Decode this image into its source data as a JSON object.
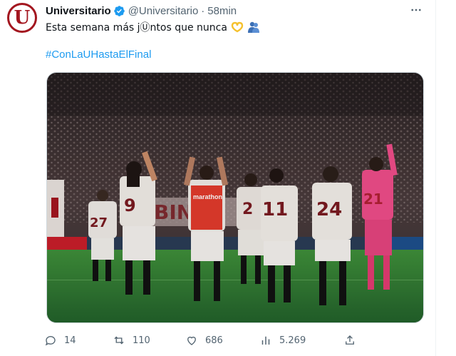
{
  "tweet": {
    "display_name": "Universitario",
    "handle": "@Universitario",
    "separator": "·",
    "time": "58min",
    "text": "Esta semana más jⓊntos que nunca",
    "hashtag": "#ConLaUHastaElFinal",
    "avatar_letter": "U",
    "emojis": [
      "heart-hands",
      "hug"
    ]
  },
  "photo": {
    "banner_text": "BINCA",
    "sponsor": "marathon",
    "jersey_numbers": [
      "27",
      "9",
      "2",
      "11",
      "24",
      "21"
    ]
  },
  "actions": {
    "replies": "14",
    "reposts": "110",
    "likes": "686",
    "views": "5.269"
  },
  "colors": {
    "brand_red": "#a3161f",
    "link_blue": "#1d9bf0",
    "muted": "#536471",
    "keeper_pink": "#ee4d8a"
  }
}
